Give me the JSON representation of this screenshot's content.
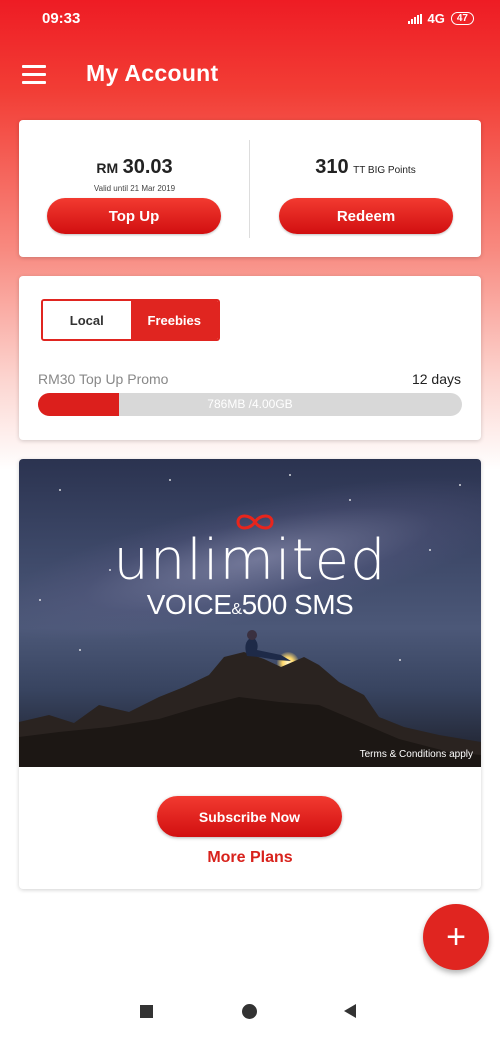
{
  "status_bar": {
    "time": "09:33",
    "network": "4G",
    "battery": "47"
  },
  "app_bar": {
    "title": "My Account"
  },
  "balance_card": {
    "currency": "RM",
    "amount": "30.03",
    "valid_until": "Valid until 21 Mar 2019",
    "topup_label": "Top Up",
    "points_value": "310",
    "points_label": "TT BIG Points",
    "redeem_label": "Redeem"
  },
  "plan_card": {
    "tabs": [
      {
        "label": "Local",
        "selected": false
      },
      {
        "label": "Freebies",
        "selected": true
      }
    ],
    "promo_name": "RM30 Top Up Promo",
    "days_left": "12 days",
    "usage_text": "786MB /4.00GB",
    "usage_fraction": 0.19
  },
  "promo_card": {
    "banner_title": "unlimited",
    "banner_voice": "VOICE",
    "banner_amp": "&",
    "banner_sms": "500 SMS",
    "tnc": "Terms & Conditions apply",
    "subscribe_label": "Subscribe Now",
    "more_plans_label": "More Plans"
  },
  "fab": {
    "icon": "plus-icon",
    "symbol": "+"
  },
  "colors": {
    "accent": "#e02520",
    "progress_bg": "#d8d8d8"
  }
}
